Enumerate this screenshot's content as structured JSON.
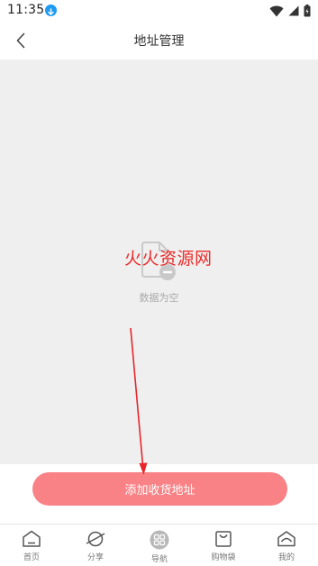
{
  "status_bar": {
    "time": "11:35"
  },
  "header": {
    "title": "地址管理"
  },
  "empty_state": {
    "message": "数据为空"
  },
  "watermark": "火火资源网",
  "actions": {
    "add_address_label": "添加收货地址"
  },
  "tabs": [
    {
      "label": "首页",
      "icon": "home-icon"
    },
    {
      "label": "分享",
      "icon": "planet-icon"
    },
    {
      "label": "导航",
      "icon": "grid-icon"
    },
    {
      "label": "购物袋",
      "icon": "bag-icon"
    },
    {
      "label": "我的",
      "icon": "profile-icon"
    }
  ],
  "colors": {
    "primary_button": "#f98286",
    "annotation_arrow": "#e8262a",
    "watermark": "#ec2a2a",
    "content_background": "#efefef"
  }
}
